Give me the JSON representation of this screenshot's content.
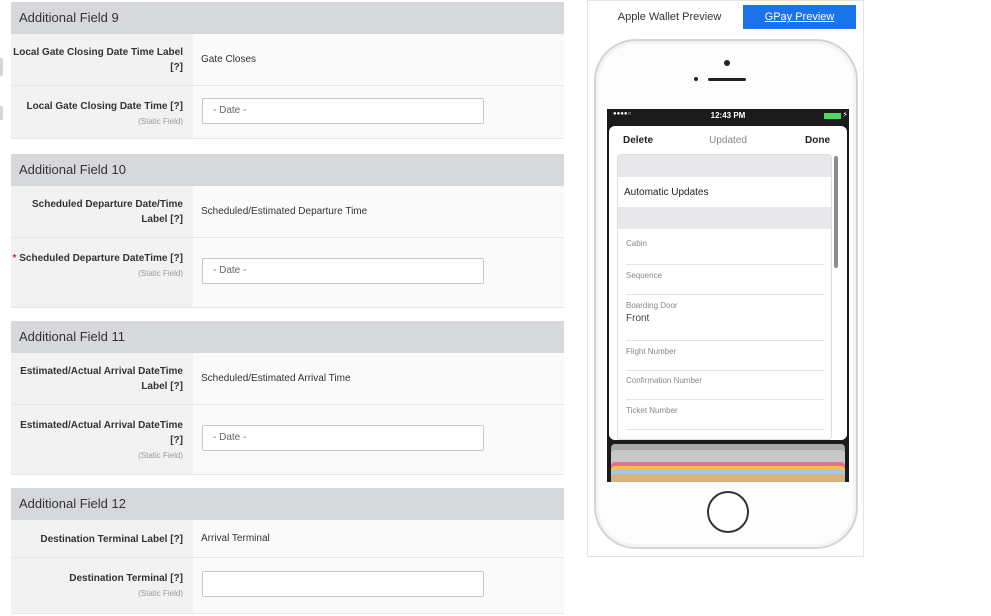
{
  "form": {
    "sections": [
      {
        "title": "Additional Field 9",
        "rows": [
          {
            "label": "Local Gate Closing Date Time Label",
            "help": "[?]",
            "value": "Gate Closes"
          },
          {
            "label": "Local Gate Closing Date Time",
            "help": "[?]",
            "static": "(Static Field)",
            "placeholder": "- Date -"
          }
        ]
      },
      {
        "title": "Additional Field 10",
        "rows": [
          {
            "label": "Scheduled Departure Date/Time Label",
            "help": "[?]",
            "value": "Scheduled/Estimated Departure Time"
          },
          {
            "required": "*",
            "label": "Scheduled Departure DateTime",
            "help": "[?]",
            "static": "(Static Field)",
            "placeholder": "- Date -"
          }
        ]
      },
      {
        "title": "Additional Field 11",
        "rows": [
          {
            "label": "Estimated/Actual Arrival DateTime Label",
            "help": "[?]",
            "value": "Scheduled/Estimated Arrival Time"
          },
          {
            "label": "Estimated/Actual Arrival DateTime",
            "help": "[?]",
            "static": "(Static Field)",
            "placeholder": "- Date -"
          }
        ]
      },
      {
        "title": "Additional Field 12",
        "rows": [
          {
            "label": "Destination Terminal Label",
            "help": "[?]",
            "value": "Arrival Terminal"
          },
          {
            "label": "Destination Terminal",
            "help": "[?]",
            "static": "(Static Field)",
            "placeholder": ""
          }
        ]
      }
    ]
  },
  "preview": {
    "tabs": {
      "apple": "Apple Wallet Preview",
      "gpay": "GPay Preview"
    },
    "accent_color": "#1a73e8",
    "status": {
      "signal": "●●●●○",
      "time": "12:43 PM",
      "charging": "⚡"
    },
    "nav": {
      "delete": "Delete",
      "updated": "Updated",
      "done": "Done"
    },
    "automatic_updates": "Automatic Updates",
    "items": [
      {
        "key": "Cabin",
        "value": ""
      },
      {
        "key": "Sequence",
        "value": ""
      },
      {
        "key": "Boarding Door",
        "value": "Front"
      },
      {
        "key": "Flight Number",
        "value": ""
      },
      {
        "key": "Confirmation Number",
        "value": ""
      },
      {
        "key": "Ticket Number",
        "value": ""
      }
    ],
    "card_colors": [
      "#a9a9a9",
      "#c8c8c8",
      "#e86f9a",
      "#f1c24b",
      "#9fc9e9",
      "#d9b17a"
    ]
  }
}
